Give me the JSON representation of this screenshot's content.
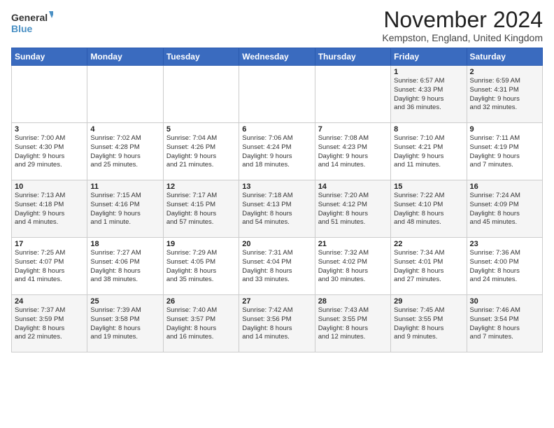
{
  "logo": {
    "line1": "General",
    "line2": "Blue"
  },
  "title": "November 2024",
  "location": "Kempston, England, United Kingdom",
  "days_of_week": [
    "Sunday",
    "Monday",
    "Tuesday",
    "Wednesday",
    "Thursday",
    "Friday",
    "Saturday"
  ],
  "weeks": [
    [
      {
        "day": "",
        "info": ""
      },
      {
        "day": "",
        "info": ""
      },
      {
        "day": "",
        "info": ""
      },
      {
        "day": "",
        "info": ""
      },
      {
        "day": "",
        "info": ""
      },
      {
        "day": "1",
        "info": "Sunrise: 6:57 AM\nSunset: 4:33 PM\nDaylight: 9 hours\nand 36 minutes."
      },
      {
        "day": "2",
        "info": "Sunrise: 6:59 AM\nSunset: 4:31 PM\nDaylight: 9 hours\nand 32 minutes."
      }
    ],
    [
      {
        "day": "3",
        "info": "Sunrise: 7:00 AM\nSunset: 4:30 PM\nDaylight: 9 hours\nand 29 minutes."
      },
      {
        "day": "4",
        "info": "Sunrise: 7:02 AM\nSunset: 4:28 PM\nDaylight: 9 hours\nand 25 minutes."
      },
      {
        "day": "5",
        "info": "Sunrise: 7:04 AM\nSunset: 4:26 PM\nDaylight: 9 hours\nand 21 minutes."
      },
      {
        "day": "6",
        "info": "Sunrise: 7:06 AM\nSunset: 4:24 PM\nDaylight: 9 hours\nand 18 minutes."
      },
      {
        "day": "7",
        "info": "Sunrise: 7:08 AM\nSunset: 4:23 PM\nDaylight: 9 hours\nand 14 minutes."
      },
      {
        "day": "8",
        "info": "Sunrise: 7:10 AM\nSunset: 4:21 PM\nDaylight: 9 hours\nand 11 minutes."
      },
      {
        "day": "9",
        "info": "Sunrise: 7:11 AM\nSunset: 4:19 PM\nDaylight: 9 hours\nand 7 minutes."
      }
    ],
    [
      {
        "day": "10",
        "info": "Sunrise: 7:13 AM\nSunset: 4:18 PM\nDaylight: 9 hours\nand 4 minutes."
      },
      {
        "day": "11",
        "info": "Sunrise: 7:15 AM\nSunset: 4:16 PM\nDaylight: 9 hours\nand 1 minute."
      },
      {
        "day": "12",
        "info": "Sunrise: 7:17 AM\nSunset: 4:15 PM\nDaylight: 8 hours\nand 57 minutes."
      },
      {
        "day": "13",
        "info": "Sunrise: 7:18 AM\nSunset: 4:13 PM\nDaylight: 8 hours\nand 54 minutes."
      },
      {
        "day": "14",
        "info": "Sunrise: 7:20 AM\nSunset: 4:12 PM\nDaylight: 8 hours\nand 51 minutes."
      },
      {
        "day": "15",
        "info": "Sunrise: 7:22 AM\nSunset: 4:10 PM\nDaylight: 8 hours\nand 48 minutes."
      },
      {
        "day": "16",
        "info": "Sunrise: 7:24 AM\nSunset: 4:09 PM\nDaylight: 8 hours\nand 45 minutes."
      }
    ],
    [
      {
        "day": "17",
        "info": "Sunrise: 7:25 AM\nSunset: 4:07 PM\nDaylight: 8 hours\nand 41 minutes."
      },
      {
        "day": "18",
        "info": "Sunrise: 7:27 AM\nSunset: 4:06 PM\nDaylight: 8 hours\nand 38 minutes."
      },
      {
        "day": "19",
        "info": "Sunrise: 7:29 AM\nSunset: 4:05 PM\nDaylight: 8 hours\nand 35 minutes."
      },
      {
        "day": "20",
        "info": "Sunrise: 7:31 AM\nSunset: 4:04 PM\nDaylight: 8 hours\nand 33 minutes."
      },
      {
        "day": "21",
        "info": "Sunrise: 7:32 AM\nSunset: 4:02 PM\nDaylight: 8 hours\nand 30 minutes."
      },
      {
        "day": "22",
        "info": "Sunrise: 7:34 AM\nSunset: 4:01 PM\nDaylight: 8 hours\nand 27 minutes."
      },
      {
        "day": "23",
        "info": "Sunrise: 7:36 AM\nSunset: 4:00 PM\nDaylight: 8 hours\nand 24 minutes."
      }
    ],
    [
      {
        "day": "24",
        "info": "Sunrise: 7:37 AM\nSunset: 3:59 PM\nDaylight: 8 hours\nand 22 minutes."
      },
      {
        "day": "25",
        "info": "Sunrise: 7:39 AM\nSunset: 3:58 PM\nDaylight: 8 hours\nand 19 minutes."
      },
      {
        "day": "26",
        "info": "Sunrise: 7:40 AM\nSunset: 3:57 PM\nDaylight: 8 hours\nand 16 minutes."
      },
      {
        "day": "27",
        "info": "Sunrise: 7:42 AM\nSunset: 3:56 PM\nDaylight: 8 hours\nand 14 minutes."
      },
      {
        "day": "28",
        "info": "Sunrise: 7:43 AM\nSunset: 3:55 PM\nDaylight: 8 hours\nand 12 minutes."
      },
      {
        "day": "29",
        "info": "Sunrise: 7:45 AM\nSunset: 3:55 PM\nDaylight: 8 hours\nand 9 minutes."
      },
      {
        "day": "30",
        "info": "Sunrise: 7:46 AM\nSunset: 3:54 PM\nDaylight: 8 hours\nand 7 minutes."
      }
    ]
  ]
}
